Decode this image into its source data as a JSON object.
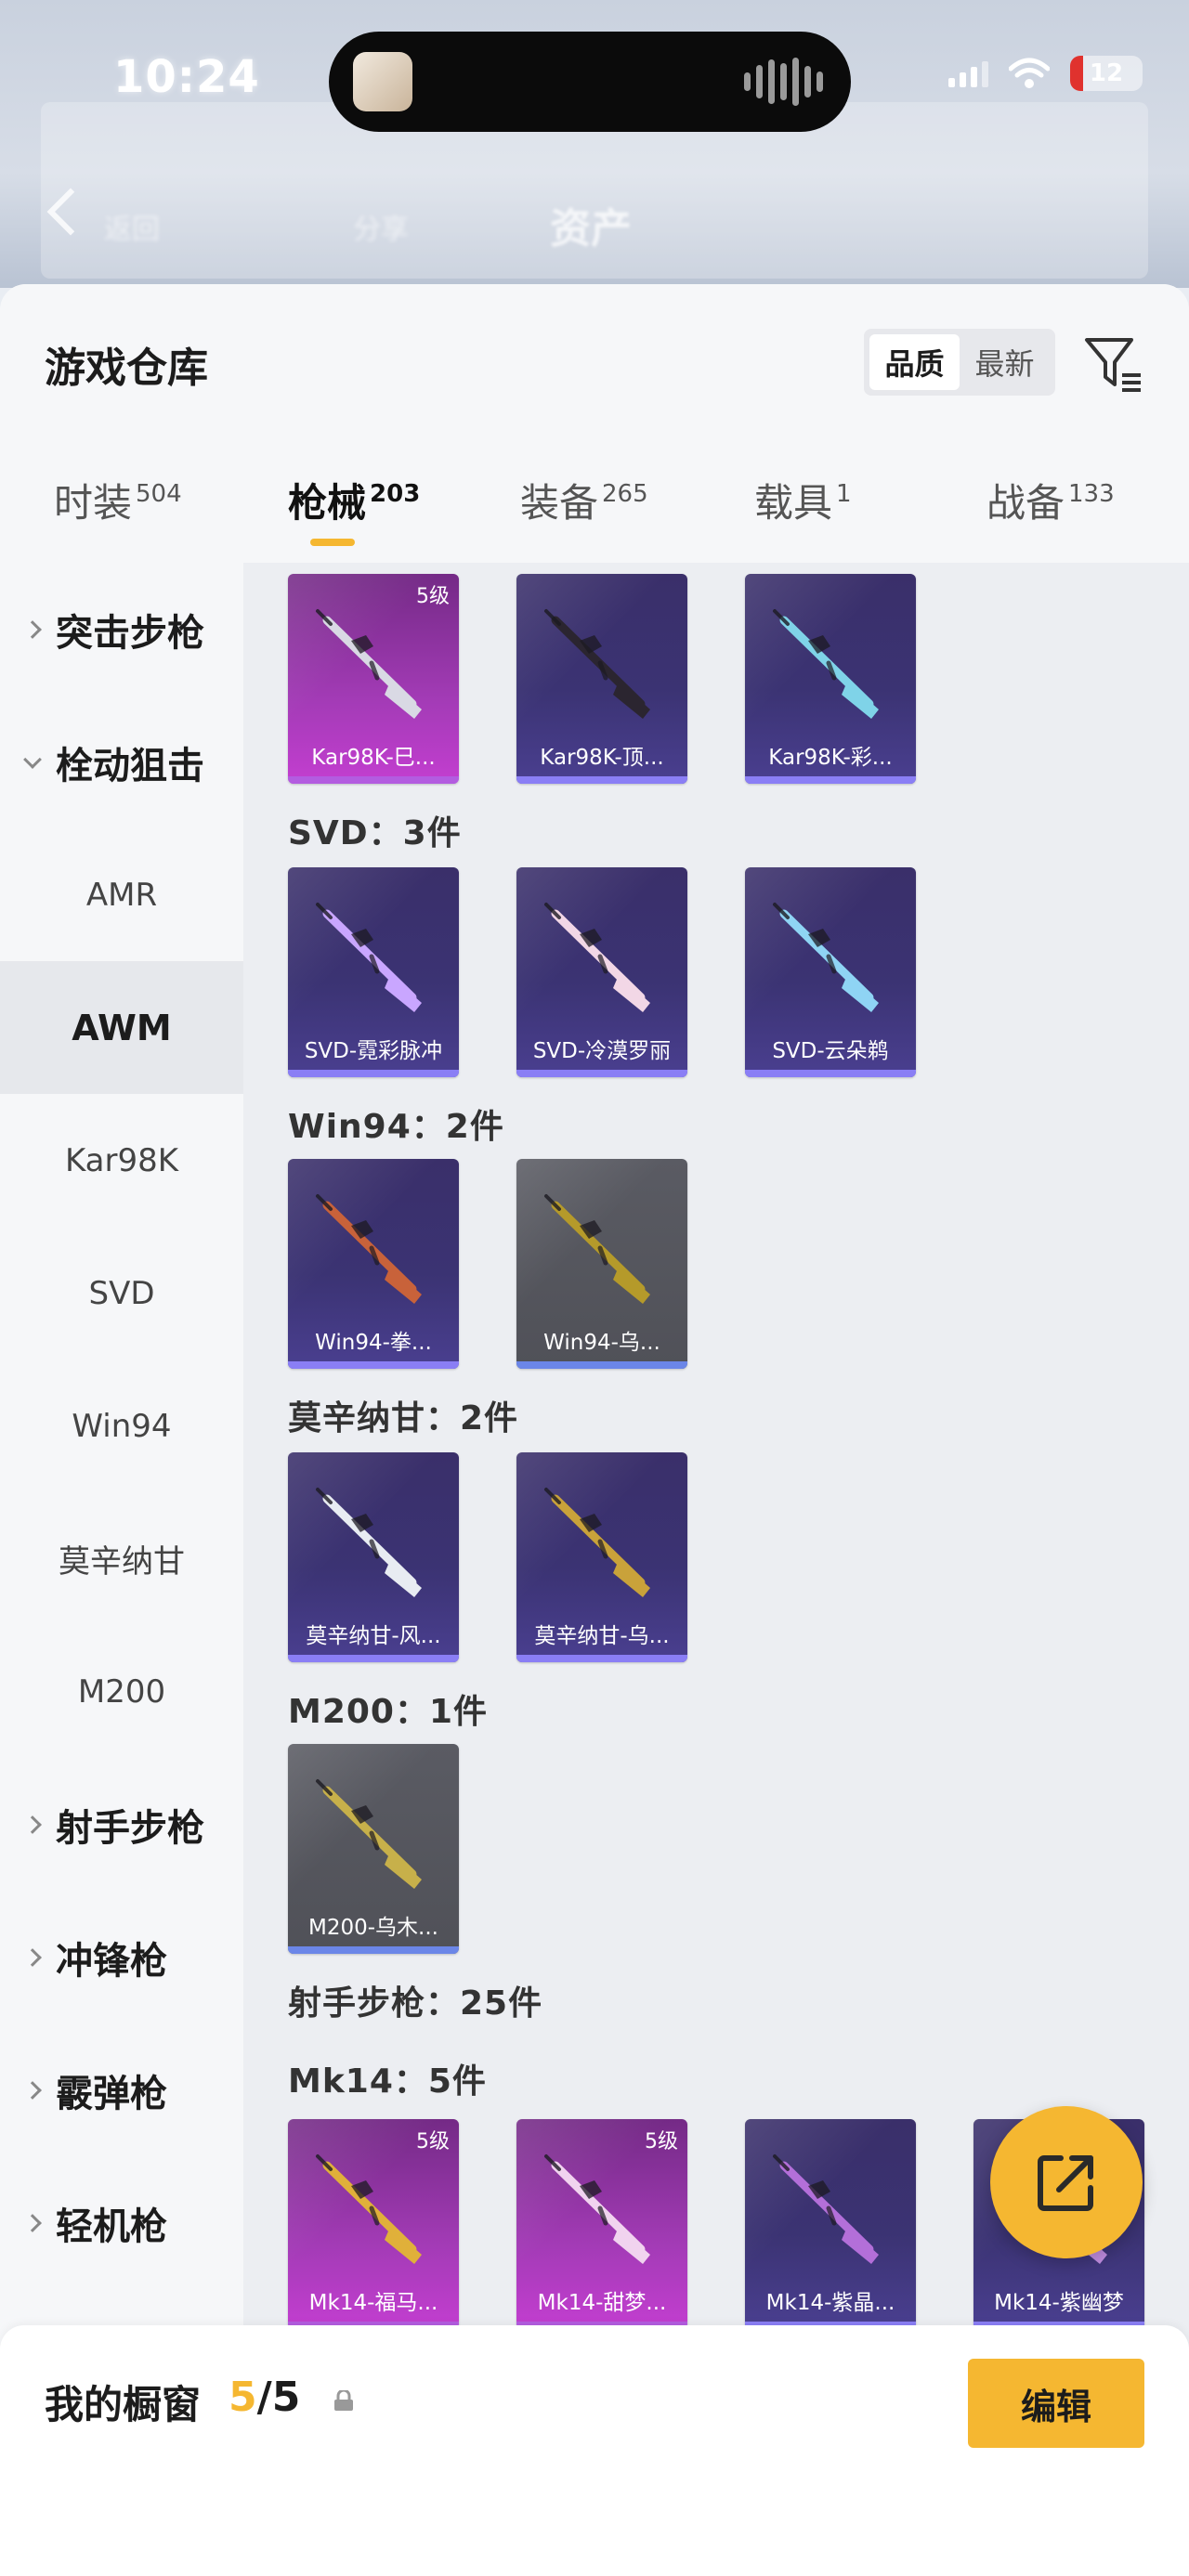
{
  "status_bar": {
    "time": "10:24",
    "battery": "12"
  },
  "app_bar": {
    "title": "资产",
    "left_hint": "返回",
    "mid_hint": "分享"
  },
  "sheet": {
    "title": "游戏仓库",
    "sort": {
      "options": [
        "品质",
        "最新"
      ],
      "selected": "品质"
    },
    "tabs": [
      {
        "label": "时装",
        "count": "504"
      },
      {
        "label": "枪械",
        "count": "203",
        "active": true
      },
      {
        "label": "装备",
        "count": "265"
      },
      {
        "label": "载具",
        "count": "1"
      },
      {
        "label": "战备",
        "count": "133"
      }
    ]
  },
  "sidenav": [
    {
      "label": "突击步枪",
      "type": "category",
      "expanded": false
    },
    {
      "label": "栓动狙击",
      "type": "category",
      "expanded": true
    },
    {
      "label": "AMR",
      "type": "sub"
    },
    {
      "label": "AWM",
      "type": "sub",
      "active": true
    },
    {
      "label": "Kar98K",
      "type": "sub"
    },
    {
      "label": "SVD",
      "type": "sub"
    },
    {
      "label": "Win94",
      "type": "sub"
    },
    {
      "label": "莫辛纳甘",
      "type": "sub"
    },
    {
      "label": "M200",
      "type": "sub"
    },
    {
      "label": "射手步枪",
      "type": "category",
      "expanded": false
    },
    {
      "label": "冲锋枪",
      "type": "category",
      "expanded": false
    },
    {
      "label": "霰弹枪",
      "type": "category",
      "expanded": false
    },
    {
      "label": "轻机枪",
      "type": "category",
      "expanded": false
    }
  ],
  "groups": {
    "kar98k": {
      "items": [
        {
          "name": "Kar98K-巳...",
          "rarity": "pink",
          "level": "5级",
          "gun_color": "#d9d9e4"
        },
        {
          "name": "Kar98K-顶...",
          "rarity": "purple",
          "gun_color": "#2b2530"
        },
        {
          "name": "Kar98K-彩...",
          "rarity": "purple",
          "gun_color": "#7fd3e8"
        }
      ]
    },
    "svd": {
      "label": "SVD：3件",
      "items": [
        {
          "name": "SVD-霓彩脉冲",
          "rarity": "purple",
          "gun_color": "#c9a6ff"
        },
        {
          "name": "SVD-冷漠罗丽",
          "rarity": "purple",
          "gun_color": "#f2d7e6"
        },
        {
          "name": "SVD-云朵鹈",
          "rarity": "purple",
          "gun_color": "#8fd4f4"
        }
      ]
    },
    "win94": {
      "label": "Win94：2件",
      "items": [
        {
          "name": "Win94-拳...",
          "rarity": "purple",
          "gun_color": "#c8623a"
        },
        {
          "name": "Win94-乌...",
          "rarity": "grey",
          "gun_color": "#b59a2a"
        }
      ]
    },
    "mosin": {
      "label": "莫辛纳甘：2件",
      "items": [
        {
          "name": "莫辛纳甘-风...",
          "rarity": "purple",
          "gun_color": "#e8ecf2"
        },
        {
          "name": "莫辛纳甘-乌...",
          "rarity": "purple",
          "gun_color": "#c9a23a"
        }
      ]
    },
    "m200": {
      "label": "M200：1件",
      "items": [
        {
          "name": "M200-乌木...",
          "rarity": "grey",
          "gun_color": "#c7b04a"
        }
      ]
    },
    "marksman": {
      "label": "射手步枪：25件"
    },
    "mk14": {
      "label": "Mk14：5件",
      "items": [
        {
          "name": "Mk14-福马...",
          "rarity": "pink",
          "level": "5级",
          "gun_color": "#e0b03a"
        },
        {
          "name": "Mk14-甜梦...",
          "rarity": "pink",
          "level": "5级",
          "gun_color": "#f1d3ef"
        },
        {
          "name": "Mk14-紫晶...",
          "rarity": "purple",
          "gun_color": "#b36fd9"
        },
        {
          "name": "Mk14-紫幽梦",
          "rarity": "purple",
          "gun_color": "#c08de0"
        }
      ]
    }
  },
  "showcase": {
    "title": "我的橱窗",
    "current": "5",
    "total": "/5",
    "edit_label": "编辑"
  },
  "colors": {
    "accent": "#f5b731",
    "pink_card": "#a33bb6",
    "purple_card": "#3b3373",
    "grey_card": "#55565d"
  }
}
